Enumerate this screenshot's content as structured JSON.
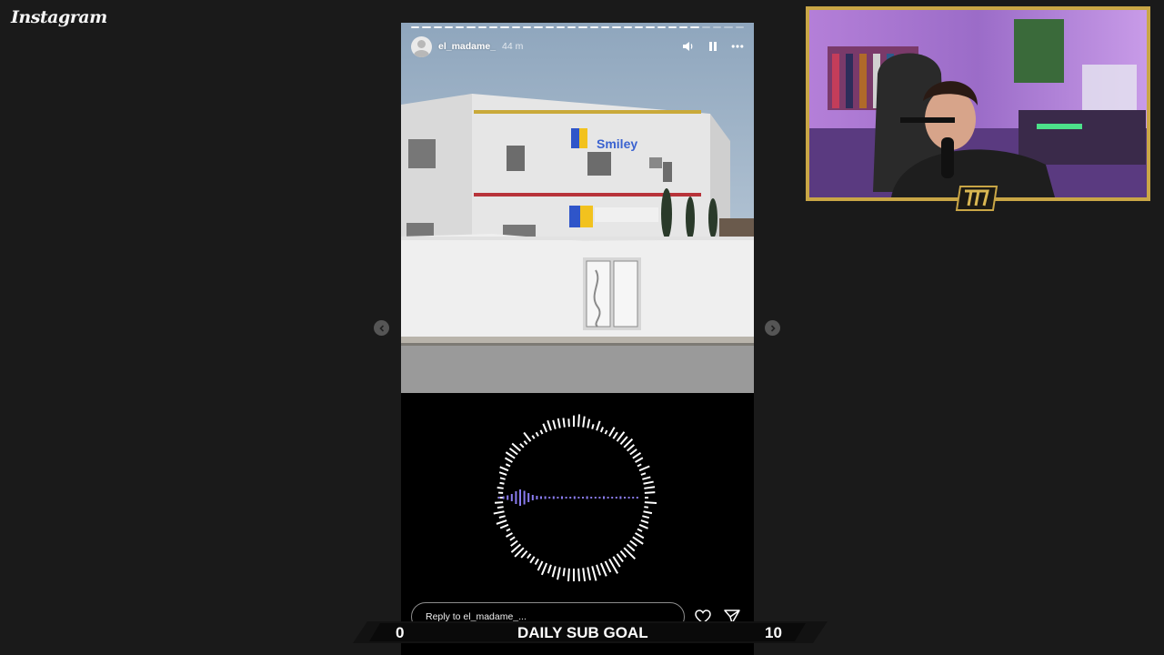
{
  "app": {
    "logo_text": "Instagram"
  },
  "story": {
    "username": "el_madame_",
    "time_ago": "44 m",
    "progress_segments_total": 30,
    "progress_segments_done": 26,
    "image_sign_text": "Smiley",
    "reply_placeholder": "Reply to el_madame_..."
  },
  "sub_goal": {
    "label": "DAILY SUB GOAL",
    "current": "0",
    "target": "10"
  },
  "colors": {
    "background": "#1a1a1a",
    "frame_gold": "#c9a646",
    "visualizer_bars": "#ffffff",
    "waveform": "#8a7cf0"
  },
  "icons": {
    "mute": "speaker-icon",
    "pause": "pause-icon",
    "more": "more-options-icon",
    "like": "heart-icon",
    "share": "send-icon",
    "prev": "chevron-left-icon",
    "next": "chevron-right-icon"
  }
}
